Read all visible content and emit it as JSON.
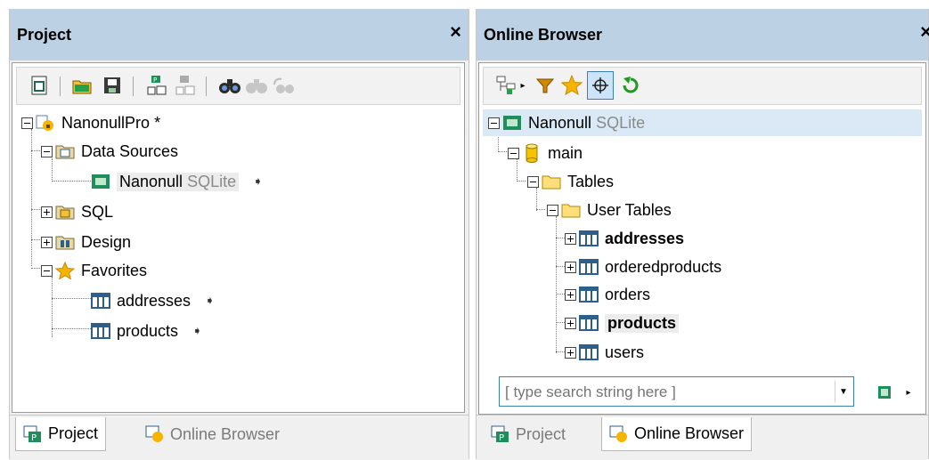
{
  "project_panel": {
    "title": "Project",
    "close": "×",
    "tree": {
      "root": "NanonullPro *",
      "data_sources": "Data Sources",
      "nanonull": "Nanonull",
      "nanonull_type": "SQLite",
      "sql": "SQL",
      "design": "Design",
      "favorites": "Favorites",
      "fav_addresses": "addresses",
      "fav_products": "products"
    },
    "tabs": [
      "Project",
      "Online Browser"
    ]
  },
  "online_panel": {
    "title": "Online Browser",
    "close": "×",
    "tree": {
      "root": "Nanonull",
      "root_type": "SQLite",
      "main": "main",
      "tables": "Tables",
      "user_tables": "User Tables",
      "items": [
        "addresses",
        "orderedproducts",
        "orders",
        "products",
        "users"
      ]
    },
    "search": {
      "placeholder": "[ type search string here ]"
    },
    "tabs": [
      "Project",
      "Online Browser"
    ]
  },
  "colors": {
    "title_bar": "#bcd1e4",
    "focus_border": "#3c7fb1",
    "favorites_star": "#f5b400",
    "refresh": "#1e9a1e"
  }
}
